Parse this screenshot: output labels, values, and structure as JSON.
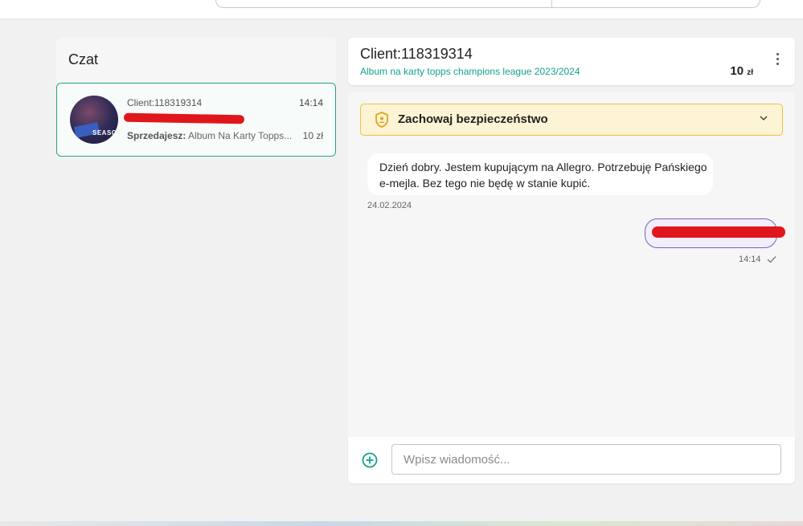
{
  "left": {
    "title": "Czat",
    "conversation": {
      "name": "Client:118319314",
      "time": "14:14",
      "seller_label": "Sprzedajesz:",
      "offer": "Album Na Karty Topps...",
      "price": "10 zł",
      "avatar_text": "SEASON"
    }
  },
  "header": {
    "title": "Client:118319314",
    "offer": "Album na karty topps champions league 2023/2024",
    "price_value": "10",
    "price_unit": "zł"
  },
  "safety": {
    "label": "Zachowaj bezpieczeństwo"
  },
  "messages": {
    "incoming_line1": "Dzień dobry. Jestem kupującym na Allegro. Potrzebuję Pańskiego",
    "incoming_line2": "e-mejla. Bez tego nie będę w stanie kupić.",
    "incoming_date": "24.02.2024",
    "outgoing_time": "14:14"
  },
  "composer": {
    "placeholder": "Wpisz wiadomość..."
  },
  "colors": {
    "accent": "#13a28a",
    "safety_bg": "#fdf3d5",
    "safety_border": "#f0c23a",
    "outgoing_border": "#7b5cc6",
    "redaction": "#e0161c"
  },
  "icons": [
    "shield-icon",
    "chevron-down-icon",
    "more-vertical-icon",
    "add-circle-icon",
    "check-icon"
  ]
}
